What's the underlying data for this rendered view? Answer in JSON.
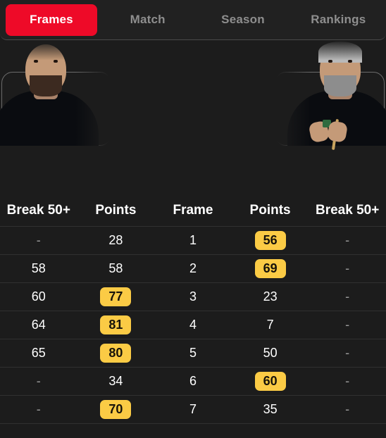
{
  "tabs": [
    {
      "label": "Frames",
      "active": true
    },
    {
      "label": "Match",
      "active": false
    },
    {
      "label": "Season",
      "active": false
    },
    {
      "label": "Rankings",
      "active": false
    }
  ],
  "players": [
    {
      "side": "left",
      "photo": "player-photo-bald-bearded-man-black-shirt"
    },
    {
      "side": "right",
      "photo": "player-photo-grey-haired-man-chalking-cue"
    }
  ],
  "table": {
    "headers": [
      "Break 50+",
      "Points",
      "Frame",
      "Points",
      "Break 50+"
    ],
    "rows": [
      {
        "left_break": "-",
        "left_points": "28",
        "frame": "1",
        "right_points": "56",
        "right_break": "-",
        "winner": "right"
      },
      {
        "left_break": "58",
        "left_points": "58",
        "frame": "2",
        "right_points": "69",
        "right_break": "-",
        "winner": "right"
      },
      {
        "left_break": "60",
        "left_points": "77",
        "frame": "3",
        "right_points": "23",
        "right_break": "-",
        "winner": "left"
      },
      {
        "left_break": "64",
        "left_points": "81",
        "frame": "4",
        "right_points": "7",
        "right_break": "-",
        "winner": "left"
      },
      {
        "left_break": "65",
        "left_points": "80",
        "frame": "5",
        "right_points": "50",
        "right_break": "-",
        "winner": "left"
      },
      {
        "left_break": "-",
        "left_points": "34",
        "frame": "6",
        "right_points": "60",
        "right_break": "-",
        "winner": "right"
      },
      {
        "left_break": "-",
        "left_points": "70",
        "frame": "7",
        "right_points": "35",
        "right_break": "-",
        "winner": "left"
      }
    ]
  },
  "colors": {
    "background": "#1c1c1c",
    "tabbar_background": "#212121",
    "active_tab": "#ee0a28",
    "badge": "#fbcb45",
    "divider": "#303030",
    "inactive_text": "#8e8e8e"
  }
}
